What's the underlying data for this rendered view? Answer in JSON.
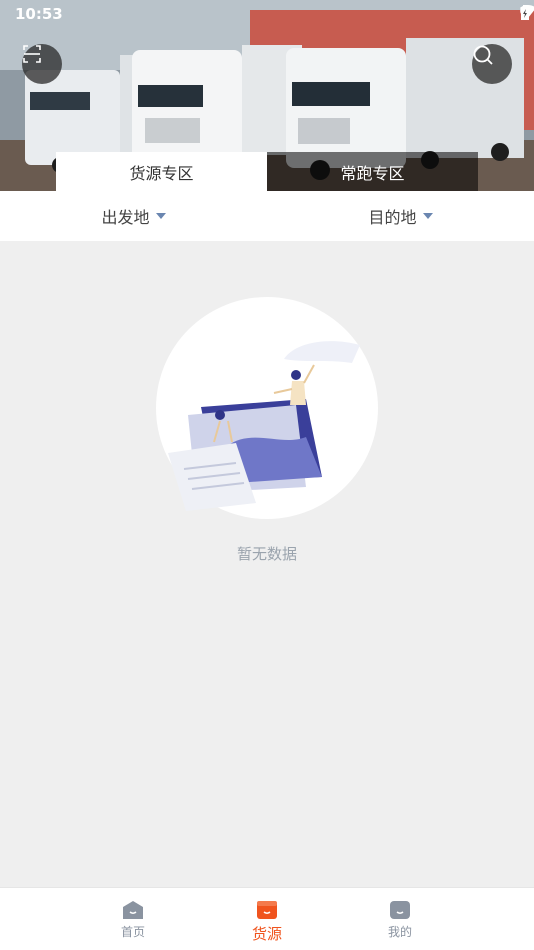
{
  "status_bar": {
    "time": "10:53"
  },
  "tabs": [
    {
      "label": "货源专区",
      "active": true
    },
    {
      "label": "常跑专区",
      "active": false
    }
  ],
  "filters": [
    {
      "label": "出发地"
    },
    {
      "label": "目的地"
    }
  ],
  "empty_state": {
    "message": "暂无数据"
  },
  "bottom_nav": [
    {
      "label": "首页",
      "icon": "home-icon"
    },
    {
      "label": "货源",
      "icon": "cargo-icon",
      "active": true
    },
    {
      "label": "我的",
      "icon": "profile-icon"
    }
  ],
  "colors": {
    "accent": "#f0541e",
    "nav_inactive": "#8a93a0",
    "caret": "#6a86b0"
  }
}
